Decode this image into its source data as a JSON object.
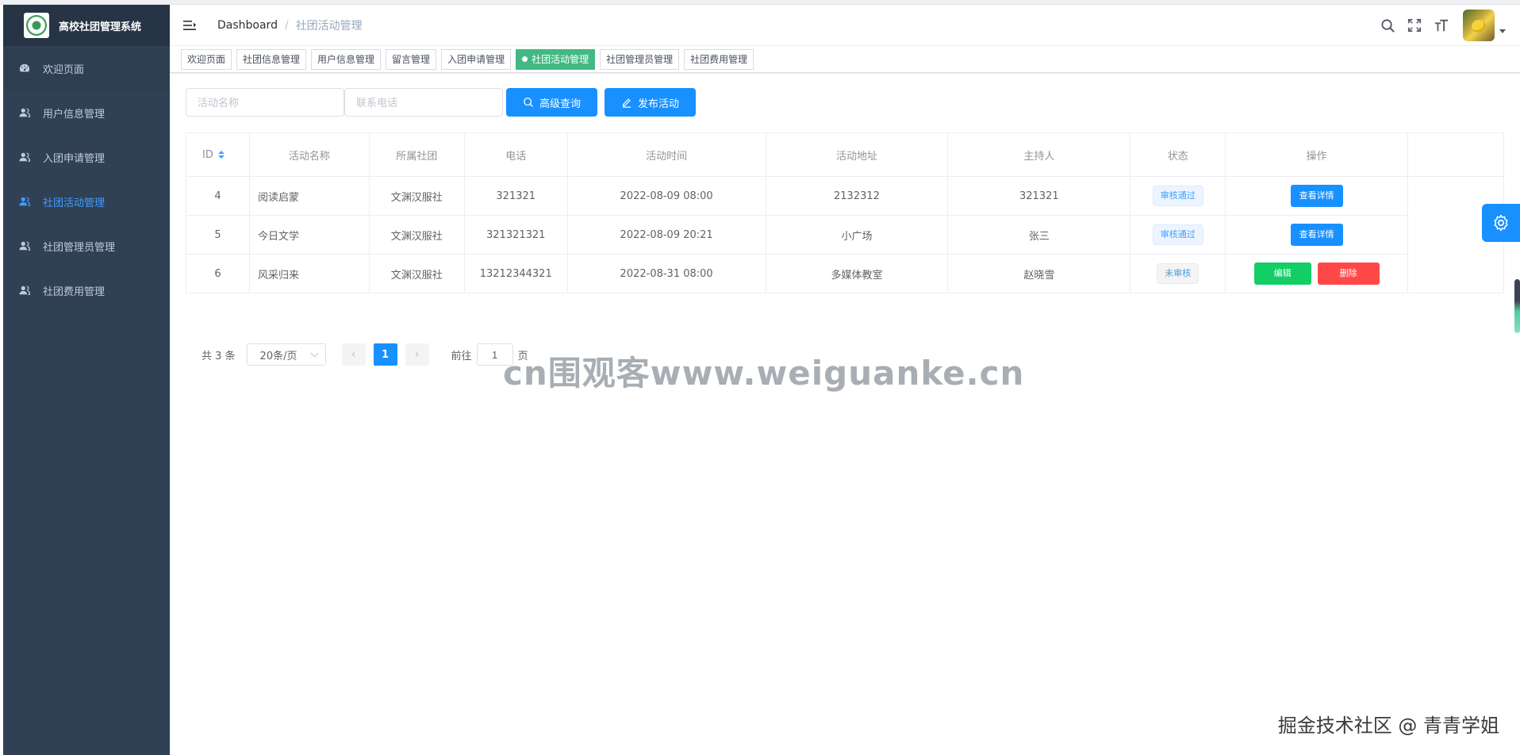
{
  "app": {
    "title": "高校社团管理系统"
  },
  "sidebar": {
    "items": [
      {
        "label": "欢迎页面",
        "icon": "dashboard-icon"
      },
      {
        "label": "用户信息管理",
        "icon": "user-icon"
      },
      {
        "label": "入团申请管理",
        "icon": "user-icon"
      },
      {
        "label": "社团活动管理",
        "icon": "user-icon",
        "active": true
      },
      {
        "label": "社团管理员管理",
        "icon": "user-icon"
      },
      {
        "label": "社团费用管理",
        "icon": "user-icon"
      }
    ]
  },
  "header": {
    "breadcrumb": [
      "Dashboard",
      "社团活动管理"
    ],
    "tools": [
      "search-icon",
      "fullscreen-icon",
      "font-size-icon"
    ]
  },
  "tags": [
    {
      "label": "欢迎页面"
    },
    {
      "label": "社团信息管理"
    },
    {
      "label": "用户信息管理"
    },
    {
      "label": "留言管理"
    },
    {
      "label": "入团申请管理"
    },
    {
      "label": "社团活动管理",
      "active": true
    },
    {
      "label": "社团管理员管理"
    },
    {
      "label": "社团费用管理"
    }
  ],
  "search": {
    "name_placeholder": "活动名称",
    "phone_placeholder": "联系电话",
    "query_button": "高级查询",
    "publish_button": "发布活动"
  },
  "table": {
    "columns": [
      "ID",
      "活动名称",
      "所属社团",
      "电话",
      "活动时间",
      "活动地址",
      "主持人",
      "状态",
      "操作"
    ],
    "rows": [
      {
        "id": "4",
        "name": "阅读启蒙",
        "club": "文渊汉服社",
        "phone": "321321",
        "time": "2022-08-09 08:00",
        "address": "2132312",
        "host": "321321",
        "status": "审核通过",
        "actions": [
          "查看详情"
        ]
      },
      {
        "id": "5",
        "name": "今日文学",
        "club": "文渊汉服社",
        "phone": "321321321",
        "time": "2022-08-09 20:21",
        "address": "小广场",
        "host": "张三",
        "status": "审核通过",
        "actions": [
          "查看详情"
        ]
      },
      {
        "id": "6",
        "name": "风采归来",
        "club": "文渊汉服社",
        "phone": "13212344321",
        "time": "2022-08-31 08:00",
        "address": "多媒体教室",
        "host": "赵晓雪",
        "status": "未审核",
        "actions": [
          "编辑",
          "删除"
        ]
      }
    ]
  },
  "pagination": {
    "total": "共 3 条",
    "page_size": "20条/页",
    "current_page": "1",
    "goto_prefix": "前往",
    "goto_value": "1",
    "goto_suffix": "页"
  },
  "watermark": "cn围观客www.weiguanke.cn",
  "footer_mark": "掘金技术社区 @ 青青学姐",
  "colors": {
    "sidebar_bg": "#304156",
    "brand_bg": "#263445",
    "active_menu": "#409eff",
    "active_tag": "#42b983",
    "primary": "#1890ff",
    "success": "#13ce66",
    "danger": "#ff4949"
  }
}
